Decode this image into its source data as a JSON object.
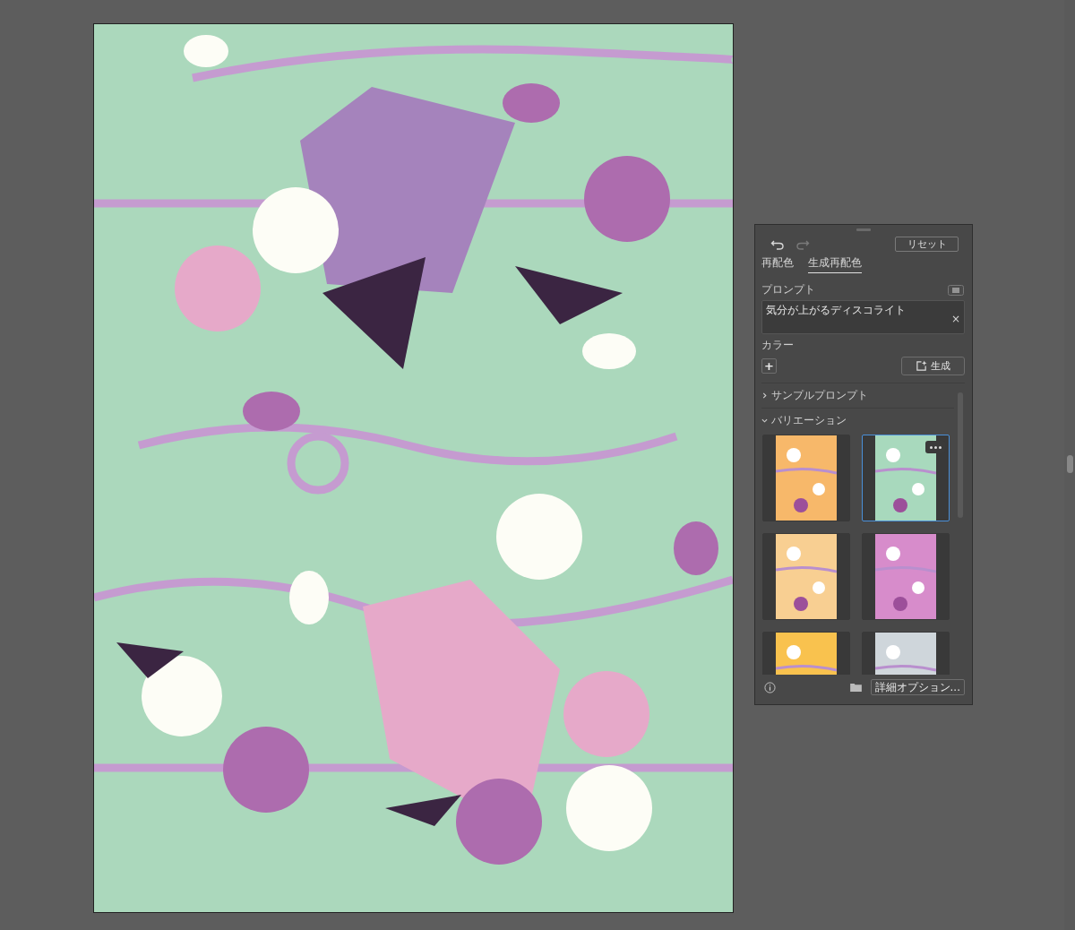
{
  "panel": {
    "reset_button": "リセット",
    "tabs": [
      {
        "label": "再配色",
        "selected": false
      },
      {
        "label": "生成再配色",
        "selected": true
      }
    ],
    "prompt": {
      "label": "プロンプト",
      "value": "気分が上がるディスコライト",
      "clear": "×"
    },
    "color": {
      "label": "カラー",
      "add": "+"
    },
    "generate_button": "生成",
    "sections": [
      {
        "label": "サンプルプロンプト",
        "expanded": false
      },
      {
        "label": "バリエーション",
        "expanded": true
      }
    ],
    "variations": [
      {
        "color": "#f7b86a",
        "selected": false
      },
      {
        "color": "#a8d9bd",
        "selected": true
      },
      {
        "color": "#f8cf92",
        "selected": false
      },
      {
        "color": "#d78ccb",
        "selected": false
      },
      {
        "color": "#f9c24e",
        "selected": false
      },
      {
        "color": "#cfd6db",
        "selected": false
      }
    ],
    "options_button": "詳細オプション..."
  }
}
